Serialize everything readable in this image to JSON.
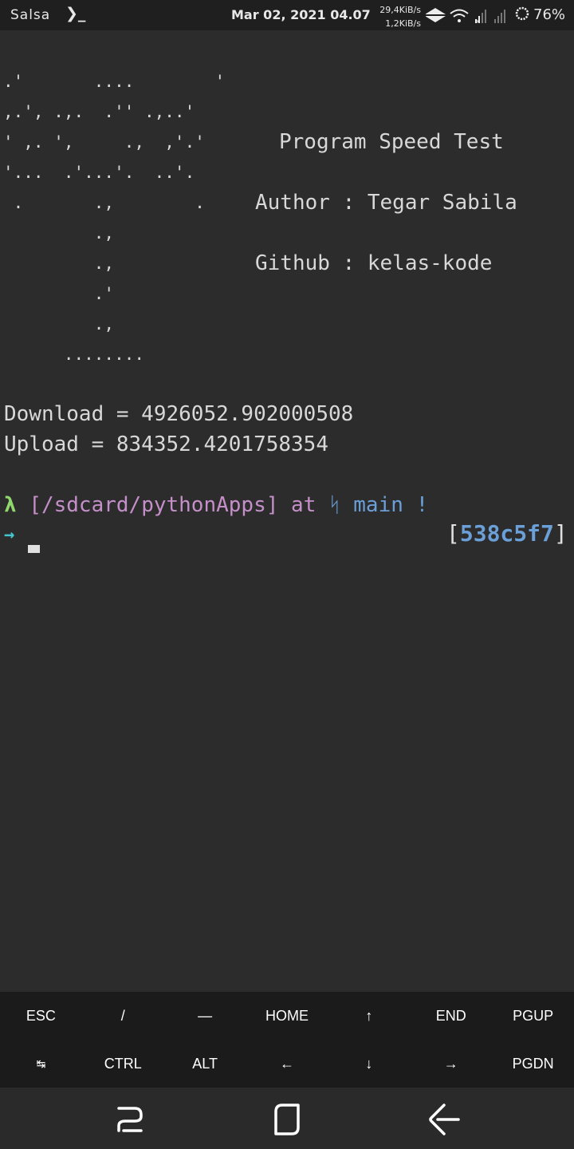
{
  "status_bar": {
    "app_name": "Salsa",
    "prompt_icon": "terminal-prompt-icon",
    "datetime": "Mar 02, 2021 04.07",
    "download_speed": "29,4KiB/s",
    "upload_speed": "1,2KiB/s",
    "icons": [
      "data-transfer-icon",
      "wifi-icon",
      "signal-x-icon",
      "signal-icon"
    ],
    "battery": "76%"
  },
  "terminal": {
    "ascii_art": ".'       ....        '\n,.', .,.  .'' .,..'\n' ,. ',     .,  ,'.'\n'...  .'...'.  ..'.\n .       .,        .\n         .,\n         .,\n         .'\n         .,\n      ........",
    "title": "Program Speed Test",
    "author": "Author : Tegar Sabila",
    "github": "Github : kelas-kode",
    "download_line": "Download = 4926052.902000508",
    "upload_line": "Upload = 834352.4201758354",
    "prompt": {
      "lambda": "λ",
      "path": "[/sdcard/pythonApps]",
      "at": "at",
      "branch_icon": "ᛋ",
      "branch": "main",
      "dirty": "!",
      "arrow": "→",
      "hash_open": "[",
      "hash": "538c5f7",
      "hash_close": "]"
    },
    "colors": {
      "background": "#2c2c2c",
      "text": "#d8d8d8",
      "path": "#c58fc9",
      "branch": "#6b9fd8",
      "lambda": "#8fd86b",
      "arrow": "#43c6cf"
    }
  },
  "extra_keys": {
    "row1": [
      "ESC",
      "/",
      "—",
      "HOME",
      "↑",
      "END",
      "PGUP"
    ],
    "row2": [
      "↹",
      "CTRL",
      "ALT",
      "←",
      "↓",
      "→",
      "PGDN"
    ]
  },
  "navbar": {
    "icons": [
      "recent-apps-icon",
      "home-icon",
      "back-icon"
    ]
  }
}
